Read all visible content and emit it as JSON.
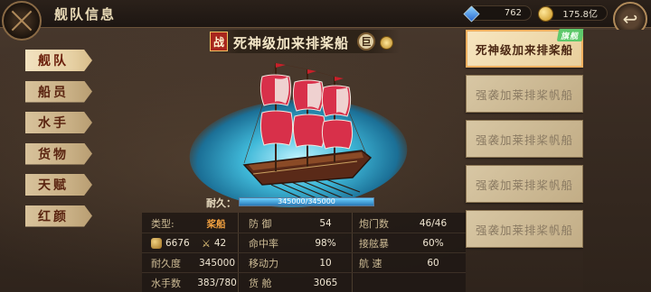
{
  "header": {
    "title": "舰队信息",
    "gems": "762",
    "gold": "175.8亿"
  },
  "tabs": [
    {
      "label": "舰队",
      "active": true
    },
    {
      "label": "船员",
      "active": false
    },
    {
      "label": "水手",
      "active": false
    },
    {
      "label": "货物",
      "active": false
    },
    {
      "label": "天赋",
      "active": false
    },
    {
      "label": "红颜",
      "active": false
    }
  ],
  "ship": {
    "battle_tag": "战",
    "name": "死神级加来排桨船",
    "size_tag": "巨",
    "durability_label": "耐久：",
    "durability_text": "345000/345000",
    "durability_fraction": 1.0
  },
  "stats": {
    "type_label": "类型:",
    "type_value": "桨船",
    "defense_label": "防  御",
    "defense_value": "54",
    "gunports_label": "炮门数",
    "gunports_value": "46/46",
    "cannon_value": "6676",
    "attack_value": "42",
    "hit_label": "命中率",
    "hit_value": "98%",
    "boarding_label": "接舷暴",
    "boarding_value": "60%",
    "durability_label": "耐久度",
    "durability_value": "345000",
    "mobility_label": "移动力",
    "mobility_value": "10",
    "speed_label": "航  速",
    "speed_value": "60",
    "sailors_label": "水手数",
    "sailors_value": "383/780",
    "cargo_label": "货  舱",
    "cargo_value": "3065"
  },
  "fleet": [
    {
      "label": "死神级加来排桨船",
      "active": true,
      "badge": "旗舰"
    },
    {
      "label": "强袭加莱排桨帆船",
      "active": false
    },
    {
      "label": "强袭加莱排桨帆船",
      "active": false
    },
    {
      "label": "强袭加莱排桨帆船",
      "active": false
    },
    {
      "label": "强袭加莱排桨帆船",
      "active": false
    }
  ],
  "colors": {
    "sail": "#d8304a",
    "hull": "#5a2a18",
    "sea": "#3fb8d8",
    "flagship_badge": "#5ec96b"
  }
}
